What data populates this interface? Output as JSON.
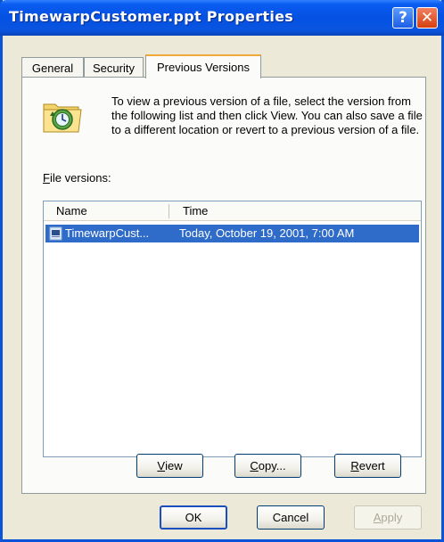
{
  "window": {
    "title": "TimewarpCustomer.ppt Properties",
    "help_glyph": "?",
    "close_glyph": "✕"
  },
  "tabs": [
    {
      "label": "General"
    },
    {
      "label": "Security"
    },
    {
      "label": "Previous Versions"
    }
  ],
  "active_tab": "Previous Versions",
  "panel": {
    "icon": "folder-clock-icon",
    "description": "To view a previous version of a file, select the version from the following list and then click View.  You can also save a file to a different location or revert to a previous version of a file.",
    "versions_label_prefix": "F",
    "versions_label_rest": "ile versions:",
    "list": {
      "columns": [
        "Name",
        "Time"
      ],
      "rows": [
        {
          "name": "TimewarpCust...",
          "time": "Today, October 19, 2001, 7:00 AM",
          "icon": "document-icon",
          "selected": true
        }
      ]
    },
    "buttons": {
      "view_u": "V",
      "view_rest": "iew",
      "copy_u": "C",
      "copy_rest": "opy...",
      "revert_u": "R",
      "revert_rest": "evert"
    }
  },
  "footer": {
    "ok": "OK",
    "cancel": "Cancel",
    "apply_u": "A",
    "apply_rest": "pply",
    "apply_disabled": true
  },
  "colors": {
    "titlebar": "#0451e2",
    "selection": "#2f6bc8",
    "active_tab_accent": "#f0a838"
  }
}
